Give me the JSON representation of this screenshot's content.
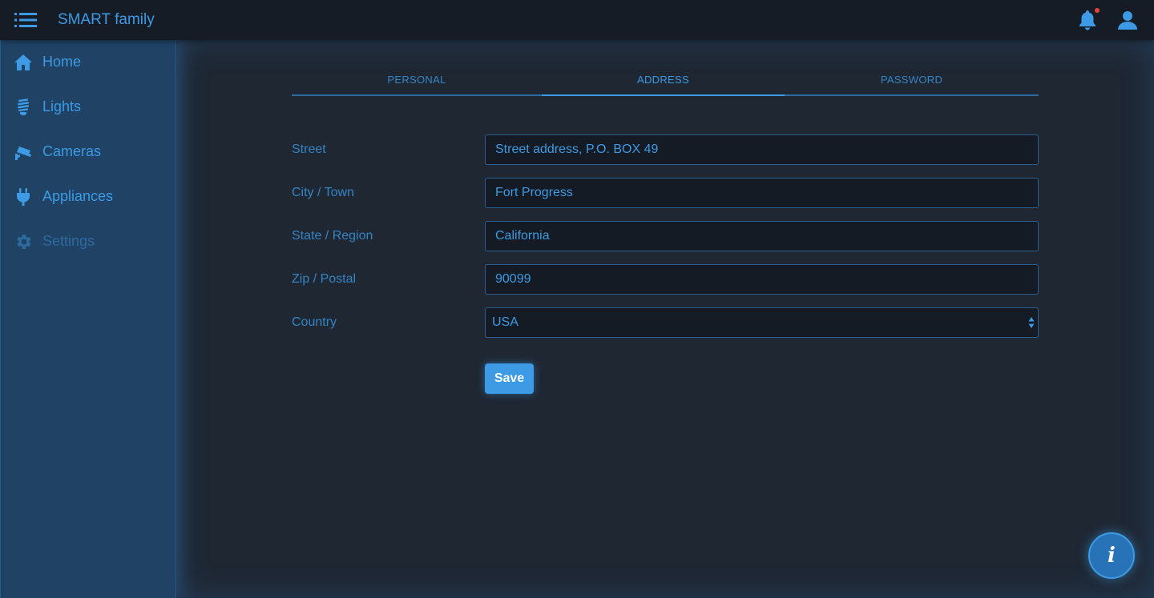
{
  "app": {
    "title": "SMART family"
  },
  "header": {
    "menu_icon": "menu-icon",
    "bell_icon": "bell-icon",
    "user_icon": "user-icon",
    "has_notification": true
  },
  "sidebar": {
    "items": [
      {
        "label": "Home",
        "icon": "home-icon"
      },
      {
        "label": "Lights",
        "icon": "bulb-icon"
      },
      {
        "label": "Cameras",
        "icon": "camera-icon"
      },
      {
        "label": "Appliances",
        "icon": "plug-icon"
      },
      {
        "label": "Settings",
        "icon": "gear-icon",
        "active": true
      }
    ]
  },
  "tabs": [
    {
      "label": "PERSONAL"
    },
    {
      "label": "ADDRESS",
      "active": true
    },
    {
      "label": "PASSWORD"
    }
  ],
  "form": {
    "street": {
      "label": "Street",
      "value": "Street address, P.O. BOX 49"
    },
    "city": {
      "label": "City / Town",
      "value": "Fort Progress"
    },
    "state": {
      "label": "State / Region",
      "value": "California"
    },
    "zip": {
      "label": "Zip / Postal",
      "value": "90099"
    },
    "country": {
      "label": "Country",
      "value": "USA"
    },
    "save_label": "Save"
  },
  "info_button": {
    "label": "i"
  },
  "colors": {
    "accent": "#3c9be4",
    "background": "#1f2733",
    "sidebar": "#1f4265",
    "topbar": "#161c26",
    "notification": "#e5413a"
  }
}
